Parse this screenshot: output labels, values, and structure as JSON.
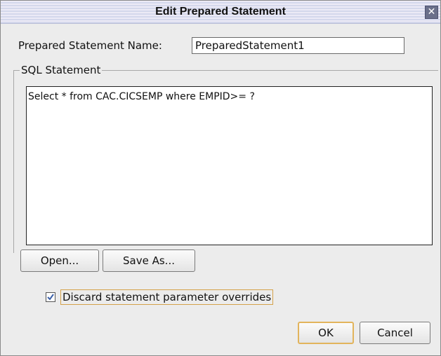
{
  "dialog": {
    "title": "Edit Prepared Statement",
    "close_glyph": "✕"
  },
  "name_field": {
    "label": "Prepared Statement Name:",
    "value": "PreparedStatement1"
  },
  "sql_group": {
    "legend": "SQL Statement",
    "value": "Select * from CAC.CICSEMP where EMPID>= ?"
  },
  "buttons": {
    "open": "Open...",
    "save_as": "Save As...",
    "ok": "OK",
    "cancel": "Cancel"
  },
  "discard_checkbox": {
    "label": "Discard statement parameter overrides",
    "checked": true
  },
  "colors": {
    "title_bar": "#d4d8ec",
    "dialog_bg": "#ececec",
    "focus_border": "#e2b45c",
    "check_mark": "#3a5fa8"
  },
  "icons": {
    "close": "close-icon",
    "check": "checkmark-icon"
  }
}
